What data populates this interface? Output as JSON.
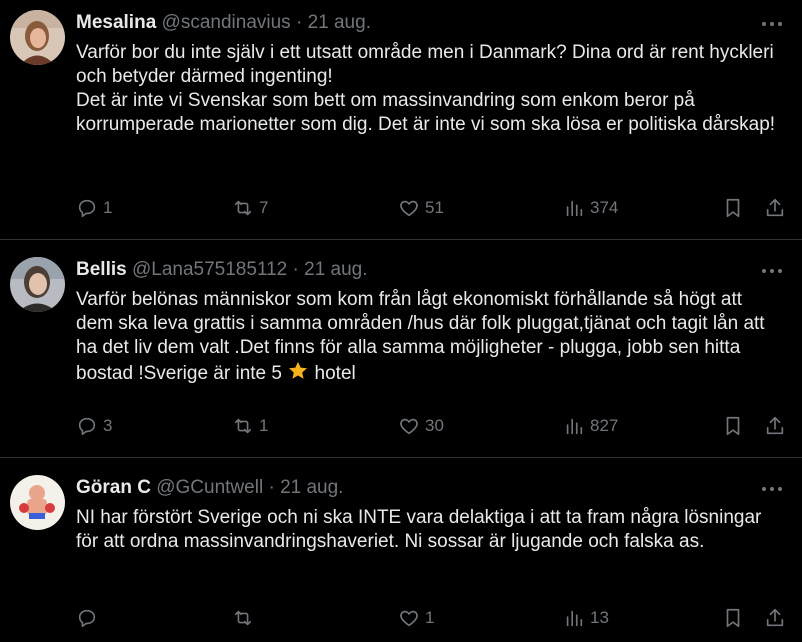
{
  "tweets": [
    {
      "name": "Mesalina",
      "handle": "@scandinavius",
      "separator": "·",
      "date": "21 aug.",
      "paragraphs": [
        "Varför bor du inte själv i ett utsatt område men i Danmark? Dina ord är rent hyckleri och betyder därmed ingenting!",
        "Det är inte vi Svenskar som bett om massinvandring som enkom beror på korrumperade marionetter som dig. Det är inte vi som ska lösa er politiska dårskap!"
      ],
      "replies": "1",
      "retweets": "7",
      "likes": "51",
      "views": "374"
    },
    {
      "name": "Bellis",
      "handle": "@Lana575185112",
      "separator": "·",
      "date": "21 aug.",
      "text_before_emoji": "Varför belönas människor som kom från lågt ekonomiskt förhållande så högt att dem ska leva grattis i samma områden /hus där folk pluggat,tjänat och tagit lån att ha det liv dem valt .Det finns för alla samma möjligheter - plugga, jobb sen hitta bostad !Sverige är inte 5",
      "text_after_emoji": "hotel",
      "replies": "3",
      "retweets": "1",
      "likes": "30",
      "views": "827"
    },
    {
      "name": "Göran C",
      "handle": "@GCuntwell",
      "separator": "·",
      "date": "21 aug.",
      "paragraphs": [
        "NI har förstört Sverige och ni ska INTE vara delaktiga i att ta fram några lösningar för att ordna massinvandringshaveriet. Ni sossar är ljugande och falska as."
      ],
      "replies": "",
      "retweets": "",
      "likes": "1",
      "views": "13"
    }
  ],
  "icons": {
    "reply": "reply-icon",
    "retweet": "retweet-icon",
    "like": "heart-icon",
    "views": "views-icon",
    "bookmark": "bookmark-icon",
    "share": "share-icon",
    "more": "more-icon",
    "emoji": "star-emoji"
  },
  "colors": {
    "background": "#000000",
    "text": "#e7e9ea",
    "secondary": "#71767b",
    "divider": "#2f3336",
    "star": "#f6b21b"
  }
}
